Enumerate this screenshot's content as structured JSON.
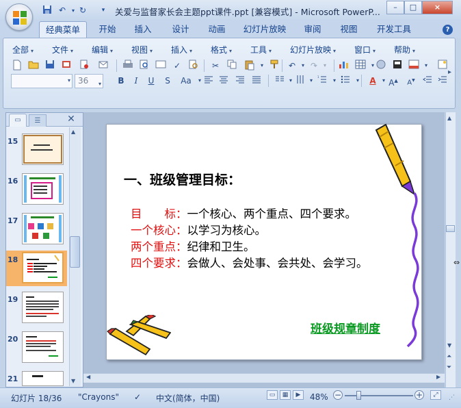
{
  "window": {
    "title": "关爱与监督家长会主题ppt课件.ppt [兼容模式] - Microsoft PowerP...",
    "controls": [
      "–",
      "□",
      "×"
    ]
  },
  "quick_access": [
    "save-icon",
    "undo-icon",
    "redo-icon",
    "customize-icon"
  ],
  "tabs": [
    "经典菜单",
    "开始",
    "插入",
    "设计",
    "动画",
    "幻灯片放映",
    "审阅",
    "视图",
    "开发工具"
  ],
  "help_label": "?",
  "menus": [
    "全部",
    "文件",
    "编辑",
    "视图",
    "插入",
    "格式",
    "工具",
    "幻灯片放映",
    "窗口",
    "帮助"
  ],
  "font": {
    "name": "",
    "size": "36"
  },
  "format_buttons": [
    "B",
    "I",
    "U",
    "S",
    "Aa"
  ],
  "panel": {
    "close_label": "✕",
    "slides": [
      {
        "num": "15"
      },
      {
        "num": "16"
      },
      {
        "num": "17"
      },
      {
        "num": "18"
      },
      {
        "num": "19"
      },
      {
        "num": "20"
      },
      {
        "num": "21"
      }
    ]
  },
  "slide": {
    "heading": "一、班级管理目标：",
    "rows": [
      {
        "label": "目　　标：",
        "value": "一个核心、两个重点、四个要求。"
      },
      {
        "label": "一个核心：",
        "value": "以学习为核心。"
      },
      {
        "label": "两个重点：",
        "value": "纪律和卫生。"
      },
      {
        "label": "四个要求：",
        "value": "会做人、会处事、会共处、会学习。"
      }
    ],
    "link": "班级规章制度"
  },
  "status": {
    "slide_info": "幻灯片 18/36",
    "theme": "\"Crayons\"",
    "language": "中文(简体，中国)",
    "zoom": "48%"
  },
  "colors": {
    "accent": "#15428b",
    "label_red": "#e01010",
    "link_green": "#0a9a22",
    "selected_thumb": "#f6b36a"
  }
}
